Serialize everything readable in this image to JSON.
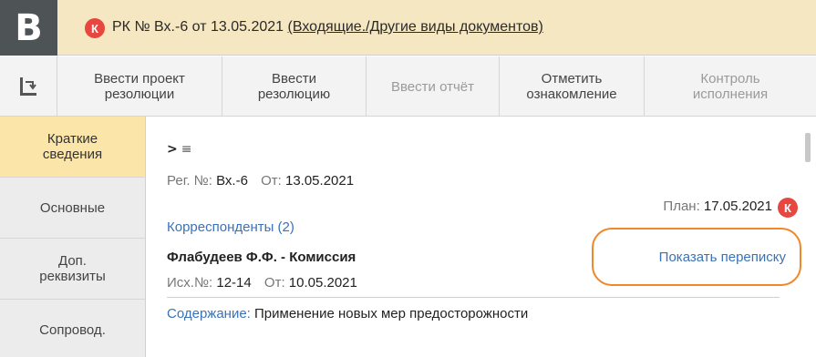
{
  "app": {
    "logo_letter": "B",
    "badge_letter": "К",
    "title_prefix": "РК № Вх.-6 от 13.05.2021 ",
    "title_link": "(Входящие./Другие виды документов)"
  },
  "toolbar": {
    "back_icon": "return-icon",
    "buttons": [
      {
        "label": "Ввести проект\nрезолюции",
        "enabled": true
      },
      {
        "label": "Ввести\nрезолюцию",
        "enabled": true
      },
      {
        "label": "Ввести отчёт",
        "enabled": false
      },
      {
        "label": "Отметить\nознакомление",
        "enabled": true
      },
      {
        "label": "Контроль\nисполнения",
        "enabled": false
      }
    ]
  },
  "sidebar": {
    "items": [
      {
        "label": "Краткие\nсведения",
        "active": true
      },
      {
        "label": "Основные",
        "active": false
      },
      {
        "label": "Доп.\nреквизиты",
        "active": false
      },
      {
        "label": "Сопровод.",
        "active": false
      }
    ]
  },
  "main": {
    "expander_arrow": ">",
    "expander_lines": "≡",
    "reg_label": "Рег. №: ",
    "reg_value": "Вх.-6",
    "from_label": "От: ",
    "from_value": "13.05.2021",
    "plan_label": "План: ",
    "plan_value": "17.05.2021",
    "correspondents_link": "Корреспонденты (2)",
    "correspondent_name": "Флабудеев Ф.Ф. - Комиссия",
    "show_correspondence": "Показать переписку",
    "out_label": "Исх.№: ",
    "out_value": "12-14",
    "out_from_label": "От: ",
    "out_from_value": "10.05.2021",
    "content_label": "Содержание: ",
    "content_value": "Применение новых мер предосторожности"
  },
  "colors": {
    "title_bg": "#f5e7c1",
    "logo_bg": "#4e5355",
    "badge": "#e8473f",
    "active_tab": "#fbe5a8",
    "link": "#3a72b8",
    "highlight_ring": "#f0882a"
  }
}
